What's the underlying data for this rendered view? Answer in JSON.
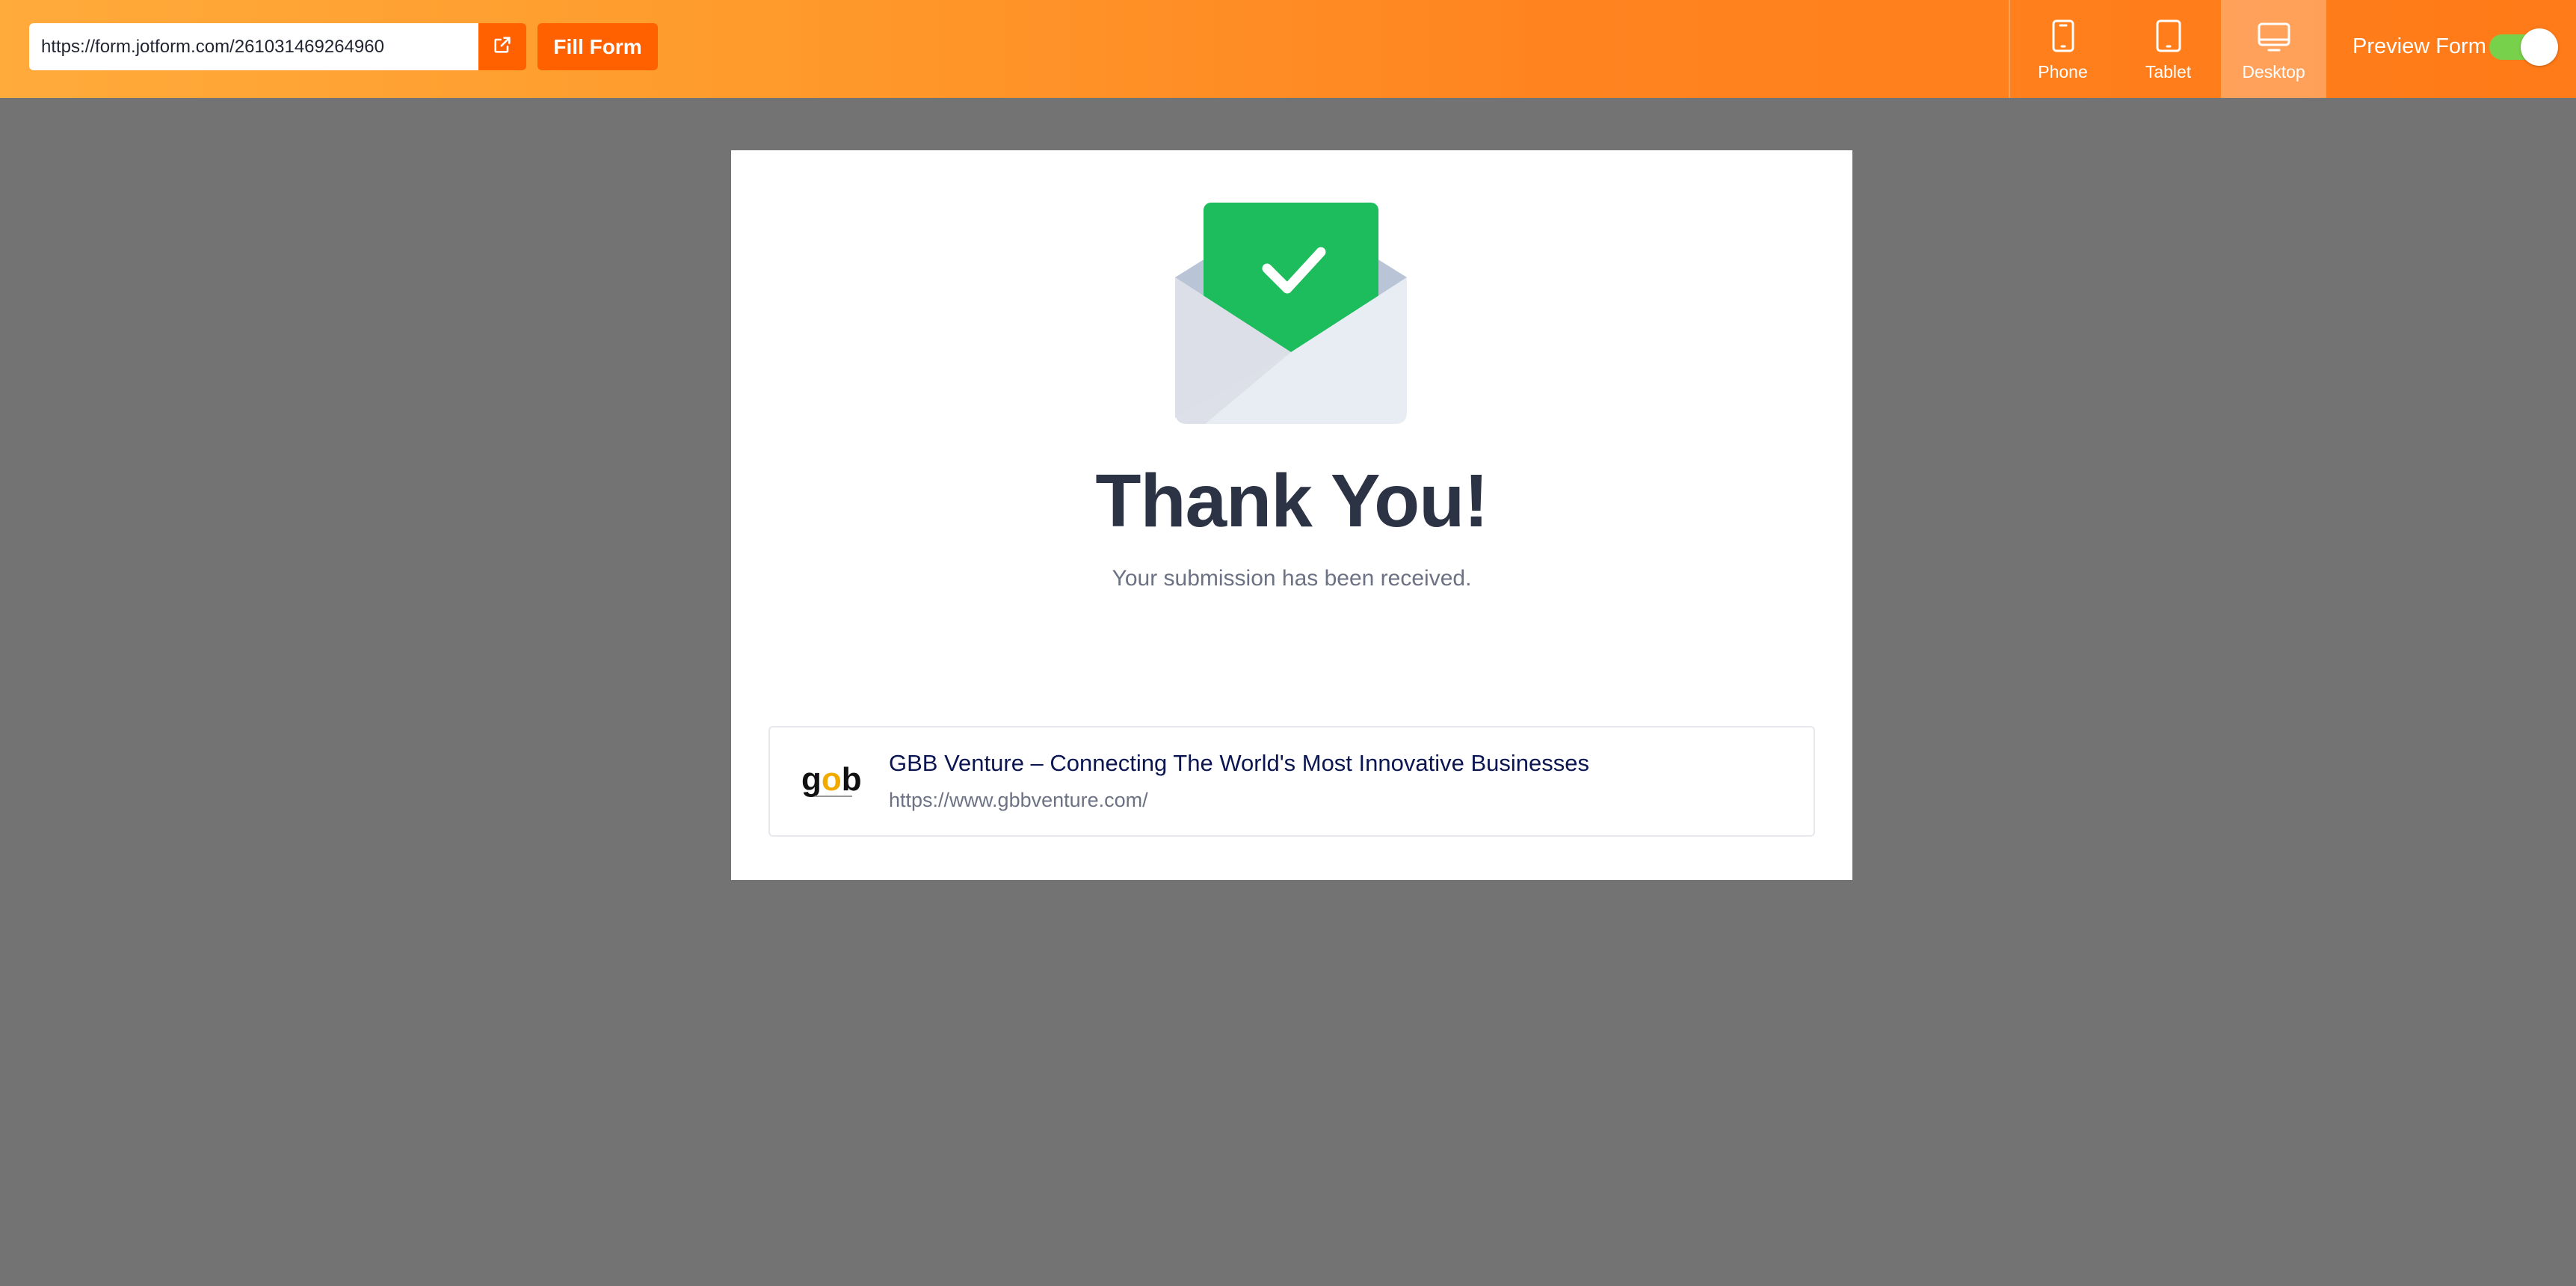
{
  "toolbar": {
    "url_value": "https://form.jotform.com/261031469264960",
    "open_link_icon": "external-link-icon",
    "fill_form_label": "Fill Form",
    "devices": [
      {
        "label": "Phone",
        "icon": "phone-icon",
        "active": false
      },
      {
        "label": "Tablet",
        "icon": "tablet-icon",
        "active": false
      },
      {
        "label": "Desktop",
        "icon": "desktop-icon",
        "active": true
      }
    ],
    "preview_label": "Preview Form",
    "preview_enabled": true
  },
  "colors": {
    "accent": "#ff6100",
    "toggle_on": "#78d14a",
    "check_green": "#1dbc5c",
    "heading": "#2c3345",
    "background": "#737373"
  },
  "thank_you": {
    "icon": "envelope-check-icon",
    "title": "Thank You!",
    "subtitle": "Your submission has been received."
  },
  "link_preview": {
    "logo_icon": "gbb-logo",
    "logo_text": "gob",
    "title": "GBB Venture – Connecting The World's Most Innovative Businesses",
    "url": "https://www.gbbventure.com/"
  }
}
